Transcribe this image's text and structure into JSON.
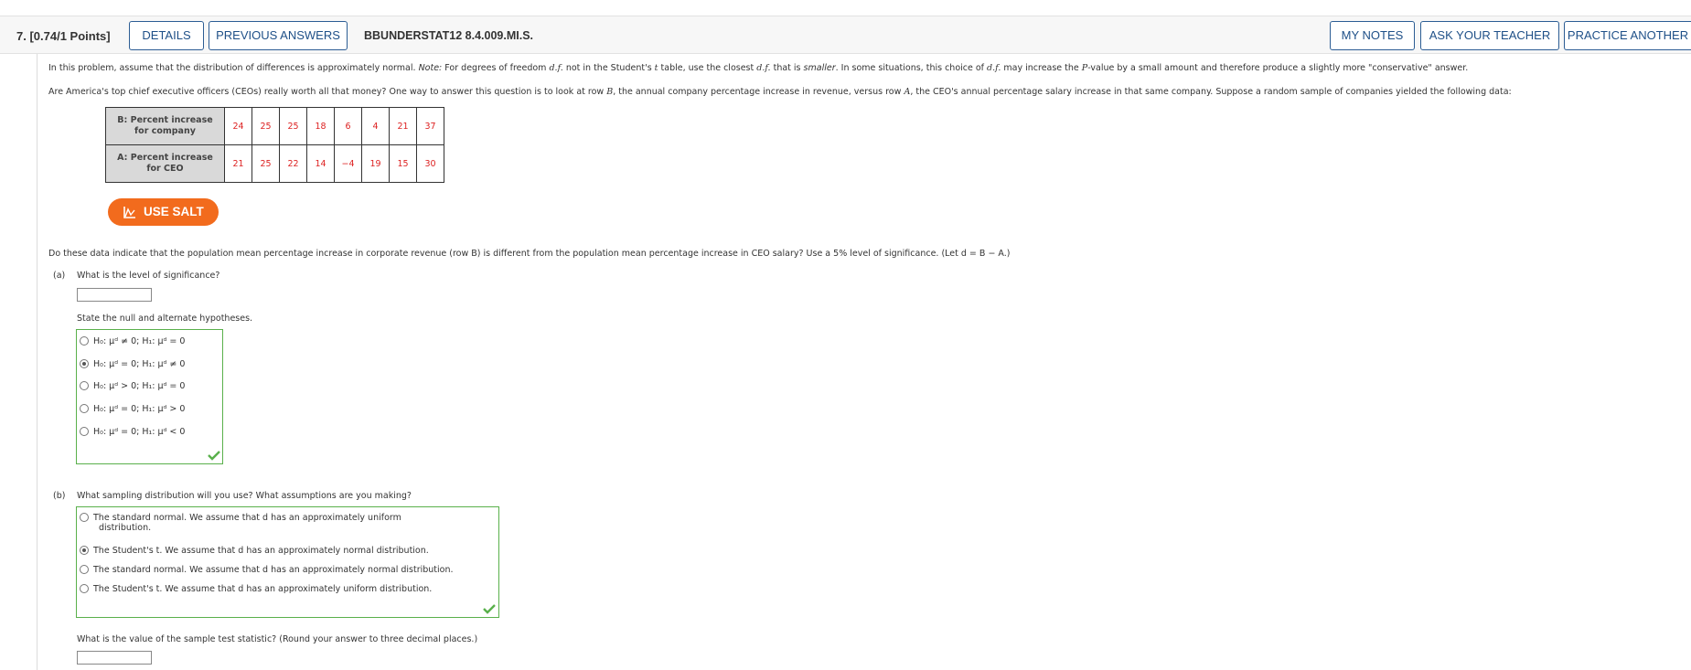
{
  "header": {
    "question_number": "7.",
    "points": "[0.74/1 Points]",
    "details_label": "DETAILS",
    "previous_answers_label": "PREVIOUS ANSWERS",
    "question_id": "BBUNDERSTAT12 8.4.009.MI.S.",
    "my_notes_label": "MY NOTES",
    "ask_teacher_label": "ASK YOUR TEACHER",
    "practice_another_label": "PRACTICE ANOTHER"
  },
  "intro": {
    "line1_a": "In this problem, assume that the distribution of differences is approximately normal.",
    "line1_note": "Note:",
    "line1_b": "For degrees of freedom",
    "line1_c": "not in the Student's",
    "line1_d": "table, use the closest",
    "line1_e": "that is",
    "line1_smaller": "smaller",
    "line1_f": ". In some situations, this choice of",
    "line1_g": "may increase the",
    "line1_h": "-value by a small amount and therefore produce a slightly more \"conservative\" answer.",
    "line2": "Are America's top chief executive officers (CEOs) really worth all that money? One way to answer this question is to look at row",
    "line2_b": ", the annual company percentage increase in revenue, versus row",
    "line2_c": ", the CEO's annual percentage salary increase in that same company. Suppose a random sample of companies yielded the following data:"
  },
  "table": {
    "row_b_label_1": "B: Percent increase",
    "row_b_label_2": "for company",
    "row_b_values": [
      "24",
      "25",
      "25",
      "18",
      "6",
      "4",
      "21",
      "37"
    ],
    "row_a_label_1": "A: Percent increase",
    "row_a_label_2": "for CEO",
    "row_a_values": [
      "21",
      "25",
      "22",
      "14",
      "−4",
      "19",
      "15",
      "30"
    ]
  },
  "salt_button": "USE SALT",
  "question_text": "Do these data indicate that the population mean percentage increase in corporate revenue (row B) is different from the population mean percentage increase in CEO salary? Use a 5% level of significance. (Let d = B − A.)",
  "part_a": {
    "label": "(a)",
    "question": "What is the level of significance?",
    "value": "",
    "hypotheses_prompt": "State the null and alternate hypotheses.",
    "selected_index": 1,
    "options": [
      "H₀: μᵈ ≠ 0; H₁: μᵈ = 0",
      "H₀: μᵈ = 0; H₁: μᵈ ≠ 0",
      "H₀: μᵈ > 0; H₁: μᵈ = 0",
      "H₀: μᵈ = 0; H₁: μᵈ > 0",
      "H₀: μᵈ = 0; H₁: μᵈ < 0"
    ]
  },
  "part_b": {
    "label": "(b)",
    "question": "What sampling distribution will you use? What assumptions are you making?",
    "selected_index": 1,
    "option1_line1": "The standard normal. We assume that d has an approximately uniform",
    "option1_line2": "distribution.",
    "option2": "The Student's t. We assume that d has an approximately normal distribution.",
    "option3": "The standard normal. We assume that d has an approximately normal distribution.",
    "option4": "The Student's t. We assume that d has an approximately uniform distribution.",
    "test_stat_prompt": "What is the value of the sample test statistic? (Round your answer to three decimal places.)",
    "test_stat_value": ""
  },
  "colors": {
    "accent_blue": "#1f5088",
    "correct_green": "#59b04b",
    "salt_orange": "#f26b1d",
    "data_red": "#dd2222"
  }
}
